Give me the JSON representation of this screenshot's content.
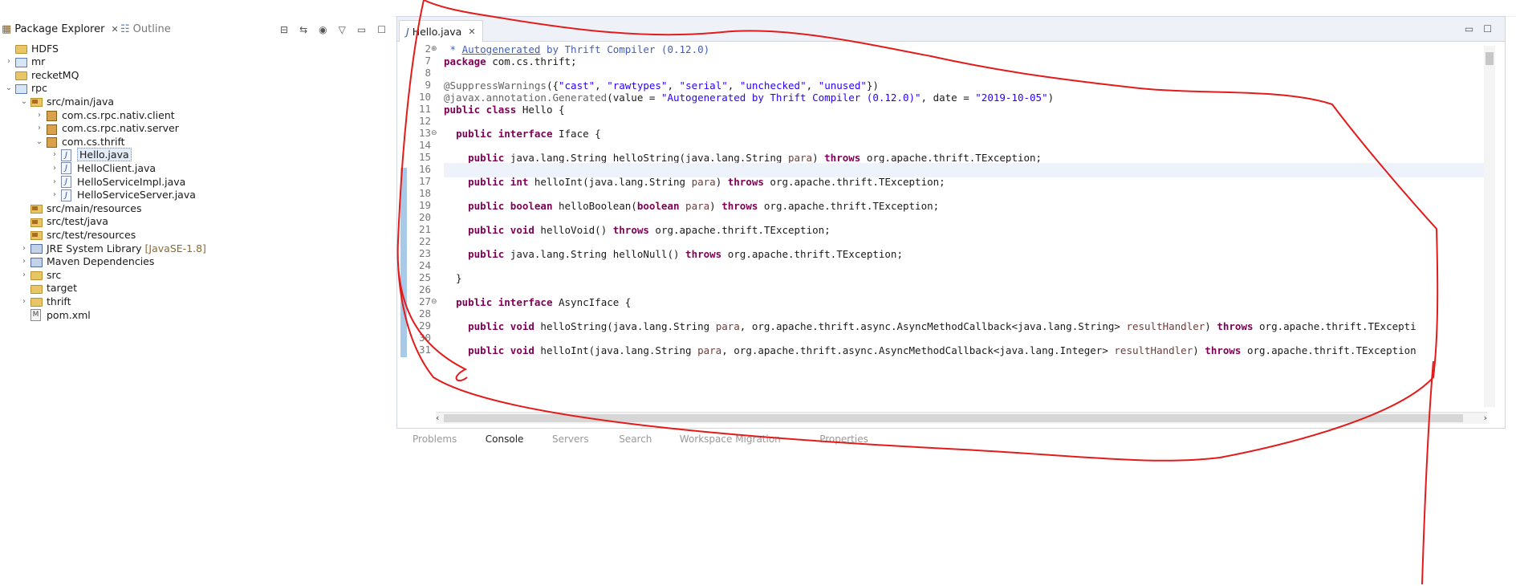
{
  "explorer": {
    "tabs": [
      {
        "label": "Package Explorer",
        "active": true
      },
      {
        "label": "Outline",
        "active": false
      }
    ],
    "tree": [
      {
        "label": "HDFS",
        "icon": "folder-icon",
        "level": 0,
        "expanded": null
      },
      {
        "label": "mr",
        "icon": "project-icon",
        "level": 0,
        "expanded": false
      },
      {
        "label": "recketMQ",
        "icon": "folder-icon",
        "level": 0,
        "expanded": null
      },
      {
        "label": "rpc",
        "icon": "project-icon",
        "level": 0,
        "expanded": true
      },
      {
        "label": "src/main/java",
        "icon": "source-folder-icon",
        "level": 1,
        "expanded": true
      },
      {
        "label": "com.cs.rpc.nativ.client",
        "icon": "package-icon",
        "level": 2,
        "expanded": false
      },
      {
        "label": "com.cs.rpc.nativ.server",
        "icon": "package-icon",
        "level": 2,
        "expanded": false
      },
      {
        "label": "com.cs.thrift",
        "icon": "package-icon",
        "level": 2,
        "expanded": true
      },
      {
        "label": "Hello.java",
        "icon": "java-file-icon",
        "level": 3,
        "expanded": false,
        "selected": true
      },
      {
        "label": "HelloClient.java",
        "icon": "java-file-icon",
        "level": 3,
        "expanded": false
      },
      {
        "label": "HelloServiceImpl.java",
        "icon": "java-file-icon",
        "level": 3,
        "expanded": false
      },
      {
        "label": "HelloServiceServer.java",
        "icon": "java-file-icon",
        "level": 3,
        "expanded": false
      },
      {
        "label": "src/main/resources",
        "icon": "source-folder-icon",
        "level": 1,
        "expanded": null
      },
      {
        "label": "src/test/java",
        "icon": "source-folder-icon",
        "level": 1,
        "expanded": null
      },
      {
        "label": "src/test/resources",
        "icon": "source-folder-icon",
        "level": 1,
        "expanded": null
      },
      {
        "label": "JRE System Library",
        "extra": "[JavaSE-1.8]",
        "icon": "library-icon",
        "level": 1,
        "expanded": false
      },
      {
        "label": "Maven Dependencies",
        "icon": "library-icon",
        "level": 1,
        "expanded": false
      },
      {
        "label": "src",
        "icon": "folder-icon",
        "level": 1,
        "expanded": false
      },
      {
        "label": "target",
        "icon": "folder-icon",
        "level": 1,
        "expanded": null
      },
      {
        "label": "thrift",
        "icon": "folder-icon",
        "level": 1,
        "expanded": false
      },
      {
        "label": "pom.xml",
        "icon": "xml-file-icon",
        "level": 1,
        "expanded": null
      }
    ]
  },
  "editor": {
    "tab_label": "Hello.java",
    "lines": [
      {
        "n": "2",
        "fold": "+",
        "html": "<span class=\"cm\"> * <u>Autogenerated</u> by Thrift Compiler (0.12.0)</span>"
      },
      {
        "n": "7",
        "html": "<span class=\"kw\">package</span> com.cs.thrift;"
      },
      {
        "n": "8",
        "html": ""
      },
      {
        "n": "9",
        "html": "<span class=\"ann\">@SuppressWarnings</span>({<span class=\"str\">\"cast\"</span>, <span class=\"str\">\"rawtypes\"</span>, <span class=\"str\">\"serial\"</span>, <span class=\"str\">\"unchecked\"</span>, <span class=\"str\">\"unused\"</span>})"
      },
      {
        "n": "10",
        "html": "<span class=\"ann\">@javax.annotation.Generated</span>(value = <span class=\"str\">\"Autogenerated by Thrift Compiler (0.12.0)\"</span>, date = <span class=\"str\">\"2019-10-05\"</span>)"
      },
      {
        "n": "11",
        "html": "<span class=\"kw\">public class</span> Hello {"
      },
      {
        "n": "12",
        "html": ""
      },
      {
        "n": "13",
        "fold": "-",
        "html": "  <span class=\"kw\">public interface</span> Iface {"
      },
      {
        "n": "14",
        "html": ""
      },
      {
        "n": "15",
        "html": "    <span class=\"kw\">public</span> java.lang.String helloString(java.lang.String <span class=\"par\">para</span>) <span class=\"kw\">throws</span> org.apache.thrift.TException;"
      },
      {
        "n": "16",
        "html": "",
        "current": true
      },
      {
        "n": "17",
        "html": "    <span class=\"kw\">public int</span> helloInt(java.lang.String <span class=\"par\">para</span>) <span class=\"kw\">throws</span> org.apache.thrift.TException;"
      },
      {
        "n": "18",
        "html": ""
      },
      {
        "n": "19",
        "html": "    <span class=\"kw\">public boolean</span> helloBoolean(<span class=\"kw\">boolean</span> <span class=\"par\">para</span>) <span class=\"kw\">throws</span> org.apache.thrift.TException;"
      },
      {
        "n": "20",
        "html": ""
      },
      {
        "n": "21",
        "html": "    <span class=\"kw\">public void</span> helloVoid() <span class=\"kw\">throws</span> org.apache.thrift.TException;"
      },
      {
        "n": "22",
        "html": ""
      },
      {
        "n": "23",
        "html": "    <span class=\"kw\">public</span> java.lang.String helloNull() <span class=\"kw\">throws</span> org.apache.thrift.TException;"
      },
      {
        "n": "24",
        "html": ""
      },
      {
        "n": "25",
        "html": "  }"
      },
      {
        "n": "26",
        "html": ""
      },
      {
        "n": "27",
        "fold": "-",
        "html": "  <span class=\"kw\">public interface</span> AsyncIface {"
      },
      {
        "n": "28",
        "html": ""
      },
      {
        "n": "29",
        "html": "    <span class=\"kw\">public void</span> helloString(java.lang.String <span class=\"par\">para</span>, org.apache.thrift.async.AsyncMethodCallback&lt;java.lang.String&gt; <span class=\"par\">resultHandler</span>) <span class=\"kw\">throws</span> org.apache.thrift.TExcepti"
      },
      {
        "n": "30",
        "html": ""
      },
      {
        "n": "31",
        "html": "    <span class=\"kw\">public void</span> helloInt(java.lang.String <span class=\"par\">para</span>, org.apache.thrift.async.AsyncMethodCallback&lt;java.lang.Integer&gt; <span class=\"par\">resultHandler</span>) <span class=\"kw\">throws</span> org.apache.thrift.TException"
      }
    ]
  },
  "bottom_tabs": [
    {
      "label": "Problems"
    },
    {
      "label": "Console",
      "active": true
    },
    {
      "label": "Servers"
    },
    {
      "label": "Search"
    },
    {
      "label": "Workspace Migration"
    },
    {
      "label": "Properties"
    }
  ]
}
